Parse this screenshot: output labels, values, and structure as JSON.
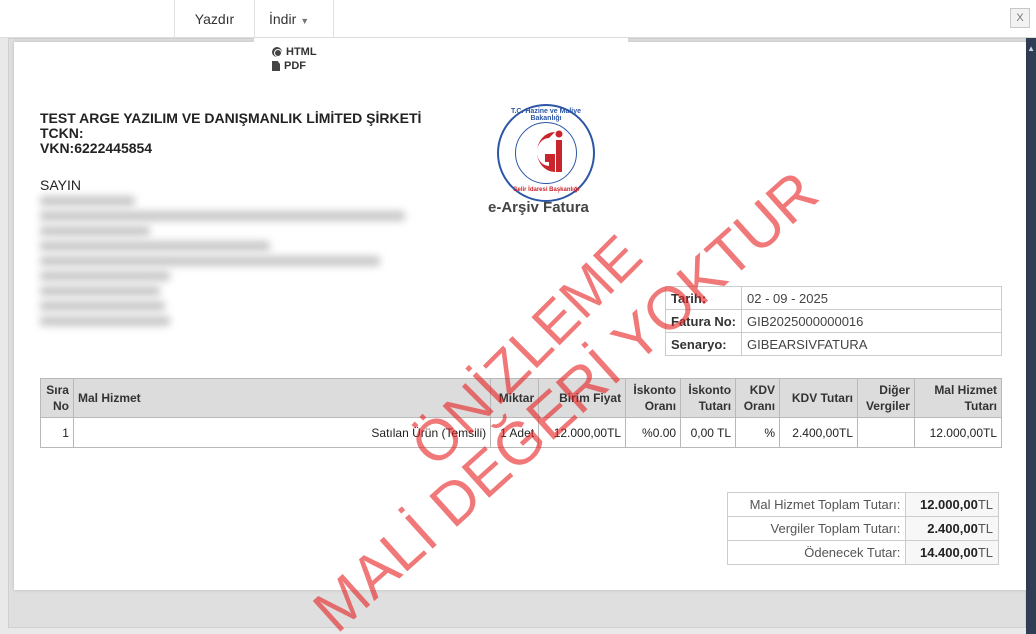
{
  "toolbar": {
    "print_label": "Yazdır",
    "download_label": "İndir",
    "close_label": "X"
  },
  "download_menu": {
    "items": [
      {
        "label": "HTML",
        "icon": "globe-icon"
      },
      {
        "label": "PDF",
        "icon": "file-icon"
      }
    ]
  },
  "invoice": {
    "company": {
      "name": "TEST ARGE YAZILIM VE DANIŞMANLIK LİMİTED ŞİRKETİ",
      "tckn": "TCKN:",
      "vkn": "VKN:6222445854"
    },
    "recipient_heading": "SAYIN",
    "logo": {
      "ring_text": "T.C. Hazine ve Maliye Bakanlığı",
      "sub_text": "Gelir İdaresi Başkanlığı"
    },
    "doc_type": "e-Arşiv Fatura",
    "meta": [
      {
        "label": "Tarih:",
        "value": "02 - 09 - 2025"
      },
      {
        "label": "Fatura No:",
        "value": "GIB2025000000016"
      },
      {
        "label": "Senaryo:",
        "value": "GIBEARSIVFATURA"
      }
    ],
    "columns": [
      "Sıra No",
      "Mal Hizmet",
      "Miktar",
      "Birim Fiyat",
      "İskonto Oranı",
      "İskonto Tutarı",
      "KDV Oranı",
      "KDV Tutarı",
      "Diğer Vergiler",
      "Mal Hizmet Tutarı"
    ],
    "rows": [
      [
        "1",
        "Satılan Ürün (Temsili)",
        "1 Adet",
        "12.000,00TL",
        "%0.00",
        "0,00 TL",
        "%",
        "2.400,00TL",
        "",
        "12.000,00TL"
      ]
    ],
    "totals": [
      {
        "label": "Mal Hizmet Toplam Tutarı:",
        "value": "12.000,00",
        "unit": "TL"
      },
      {
        "label": "Vergiler Toplam Tutarı:",
        "value": "2.400,00",
        "unit": "TL"
      },
      {
        "label": "Ödenecek Tutar:",
        "value": "14.400,00",
        "unit": "TL"
      }
    ]
  },
  "watermark": {
    "line1": "ÖNİZLEME",
    "line2": "MALİ DEĞERİ YOKTUR",
    "color": "#e61e1e"
  },
  "colors": {
    "accent_blue": "#2c57a6",
    "accent_red": "#c8252c",
    "header_gray": "#dcdcdc"
  }
}
